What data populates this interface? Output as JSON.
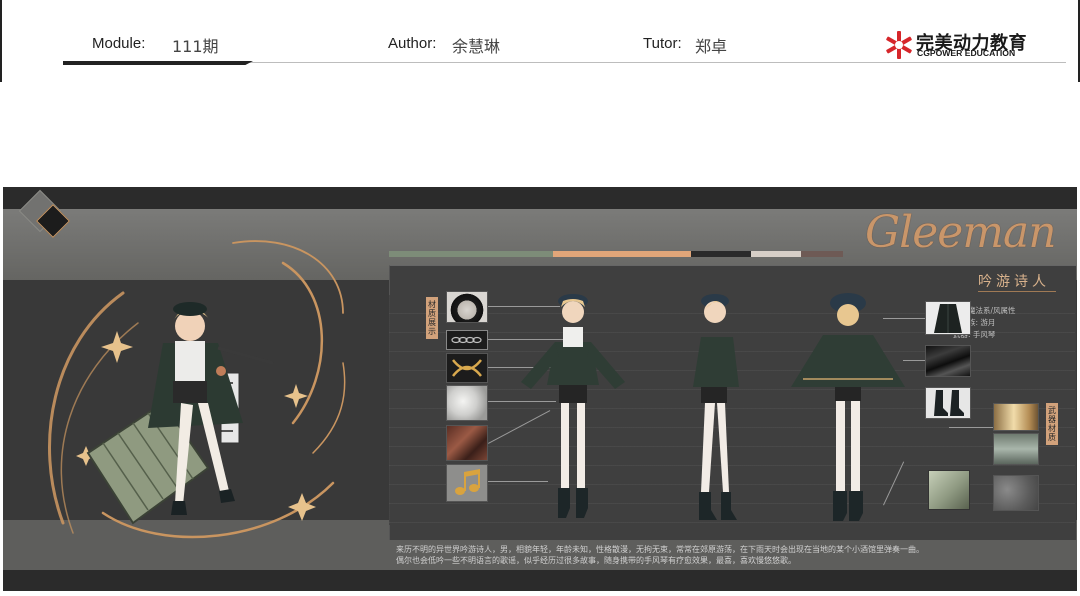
{
  "header": {
    "module_label": "Module:",
    "module_value": "111期",
    "author_label": "Author:",
    "author_value": "余慧琳",
    "tutor_label": "Tutor:",
    "tutor_value": "郑卓",
    "logo_cn": "完美动力教育",
    "logo_en": "CGPOWER EDUCATION"
  },
  "board": {
    "title_en": "Gleeman",
    "title_cn": "吟游诗人",
    "material_tag": "材质展示",
    "weapon_tag": "武器材质",
    "spec_lines": [
      "近程魔法系/风属性",
      "所属族: 游月",
      "武器: 手风琴"
    ],
    "description_lines": [
      "来历不明的异世界吟游诗人，男，相貌年轻，年龄未知，性格散漫，无拘无束，常常在郊原游荡，在下雨天时会出现在当地的某个小酒馆里弹奏一曲。",
      "偶尔也会低吟一些不明语言的歌谣，似乎经历过很多故事，随身携带的手风琴有疗愈效果，最喜，喜欢慢悠悠歌。"
    ],
    "palette": [
      "#7d8c78",
      "#e1a679",
      "#2a2a2a",
      "#d7cfc7",
      "#6e5a55"
    ],
    "accent_color": "#c9966a"
  }
}
